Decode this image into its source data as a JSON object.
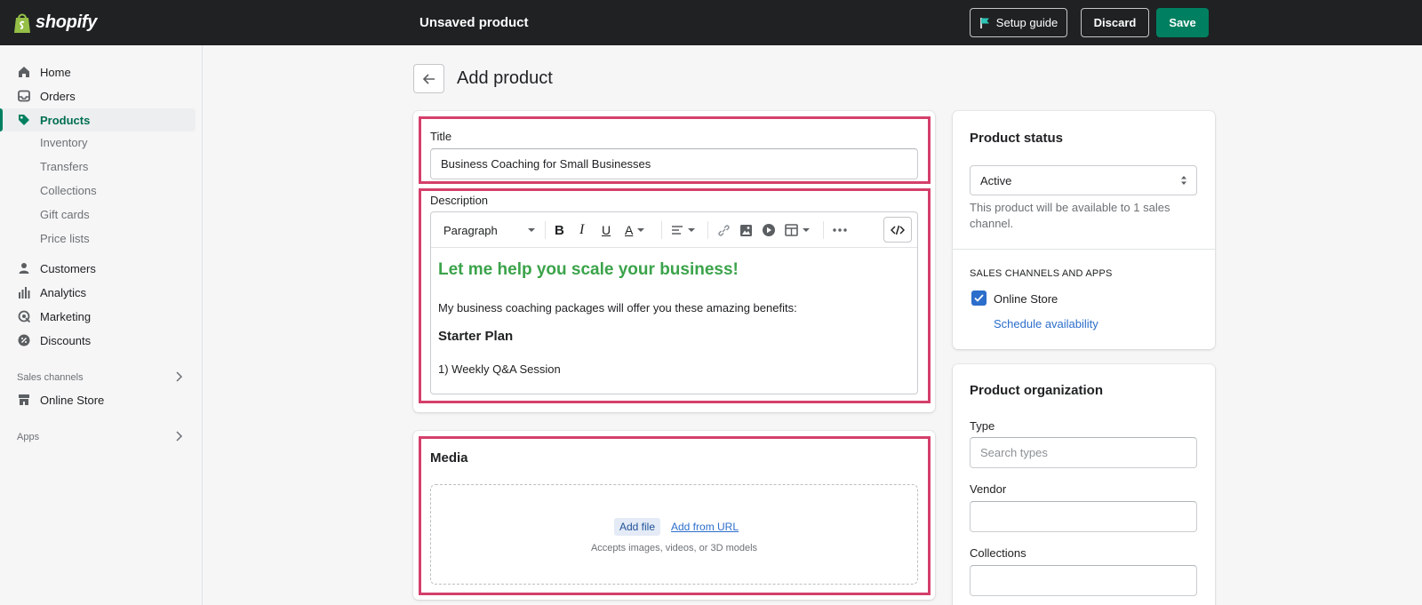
{
  "topbar": {
    "logo_text": "shopify",
    "title": "Unsaved product",
    "setup_guide": "Setup guide",
    "discard": "Discard",
    "save": "Save"
  },
  "sidebar": {
    "items": [
      {
        "label": "Home",
        "icon": "home-icon"
      },
      {
        "label": "Orders",
        "icon": "orders-icon"
      },
      {
        "label": "Products",
        "icon": "tag-icon",
        "active": true
      },
      {
        "label": "Customers",
        "icon": "person-icon"
      },
      {
        "label": "Analytics",
        "icon": "bar-chart-icon"
      },
      {
        "label": "Marketing",
        "icon": "target-icon"
      },
      {
        "label": "Discounts",
        "icon": "discount-icon"
      }
    ],
    "product_subitems": [
      "Inventory",
      "Transfers",
      "Collections",
      "Gift cards",
      "Price lists"
    ],
    "sales_channels_label": "Sales channels",
    "online_store": "Online Store",
    "apps_label": "Apps"
  },
  "page": {
    "title": "Add product"
  },
  "title_field": {
    "label": "Title",
    "value": "Business Coaching for Small Businesses"
  },
  "description": {
    "label": "Description",
    "paragraph_style": "Paragraph",
    "heading": "Let me help you scale your business!",
    "intro": "My business coaching packages will offer you these amazing benefits:",
    "subheading": "Starter Plan",
    "list_item": "1) Weekly Q&A Session"
  },
  "media": {
    "title": "Media",
    "add_file": "Add file",
    "add_url": "Add from URL",
    "accepts": "Accepts images, videos, or 3D models"
  },
  "product_status": {
    "title": "Product status",
    "status_value": "Active",
    "help_text": "This product will be available to 1 sales channel.",
    "channels_heading": "SALES CHANNELS AND APPS",
    "online_store": "Online Store",
    "online_store_checked": true,
    "schedule": "Schedule availability"
  },
  "organization": {
    "title": "Product organization",
    "type_label": "Type",
    "type_placeholder": "Search types",
    "vendor_label": "Vendor",
    "vendor_value": "",
    "collections_label": "Collections",
    "collections_value": ""
  },
  "colors": {
    "topbar": "#1f2123",
    "save_button": "#008060",
    "heading_green": "#3ba34a",
    "highlight": "#d43f6b",
    "link": "#2c6ecb"
  }
}
